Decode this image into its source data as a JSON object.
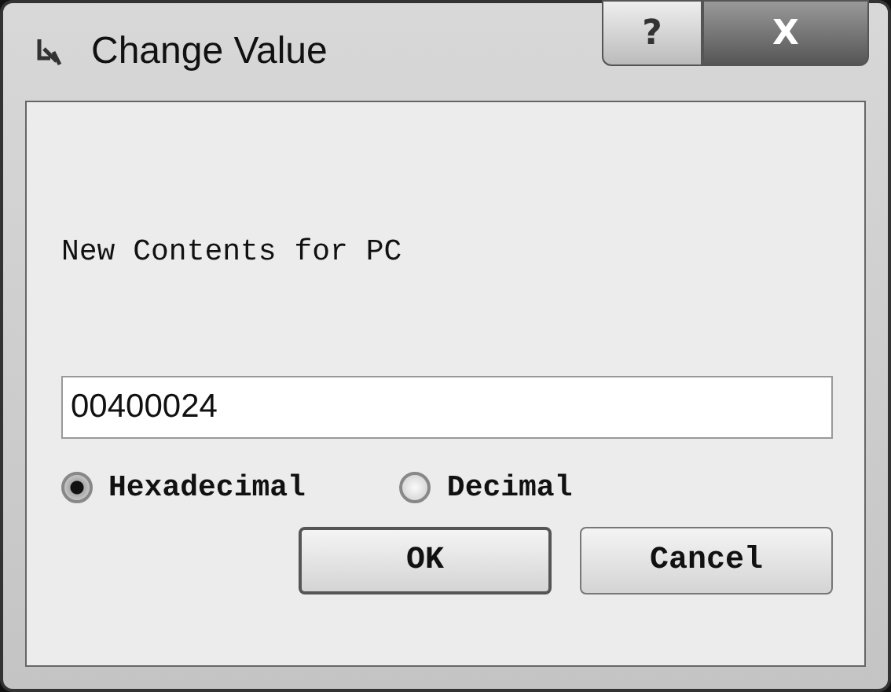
{
  "window": {
    "title": "Change Value"
  },
  "title_buttons": [
    {
      "kind": "help",
      "label": "?"
    },
    {
      "kind": "close",
      "label": "X"
    }
  ],
  "prompt": "New Contents for PC",
  "value_field": {
    "value": "00400024"
  },
  "radix": [
    {
      "label": "Hexadecimal",
      "selected": true
    },
    {
      "label": "Decimal",
      "selected": false
    }
  ],
  "buttons": [
    {
      "label": "OK",
      "default": true
    },
    {
      "label": "Cancel",
      "default": false
    }
  ]
}
